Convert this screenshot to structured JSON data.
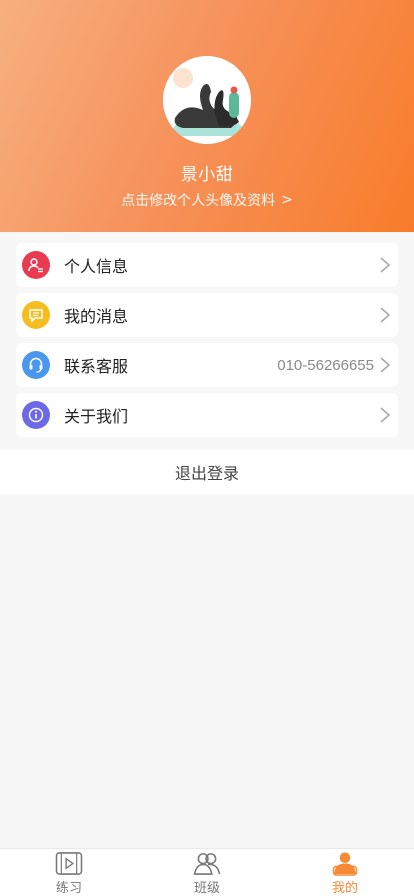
{
  "profile": {
    "username": "景小甜",
    "edit_text": "点击修改个人头像及资料",
    "edit_chevron": ">"
  },
  "menu": [
    {
      "label": "个人信息",
      "icon": "user-card-icon",
      "color": "#ea3a4f",
      "value": ""
    },
    {
      "label": "我的消息",
      "icon": "message-bubble-icon",
      "color": "#f5bd1f",
      "value": ""
    },
    {
      "label": "联系客服",
      "icon": "headset-icon",
      "color": "#4c97ee",
      "value": "010-56266655"
    },
    {
      "label": "关于我们",
      "icon": "info-icon",
      "color": "#6c68e6",
      "value": ""
    }
  ],
  "logout_label": "退出登录",
  "tabs": [
    {
      "label": "练习",
      "icon": "video-practice-icon",
      "active": false
    },
    {
      "label": "班级",
      "icon": "group-class-icon",
      "active": false
    },
    {
      "label": "我的",
      "icon": "person-profile-icon",
      "active": true
    }
  ],
  "colors": {
    "accent": "#f68a36",
    "header_gradient_start": "#f6b07f",
    "header_gradient_end": "#f87c2a"
  }
}
